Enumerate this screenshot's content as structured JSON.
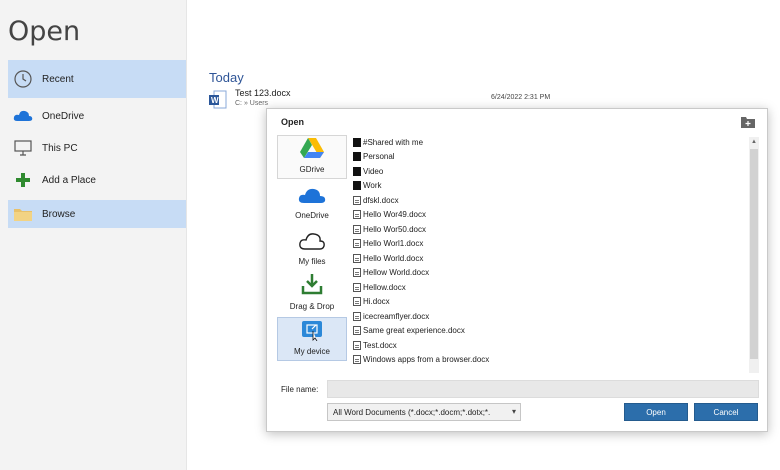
{
  "page": {
    "title": "Open"
  },
  "nav": {
    "recent": "Recent",
    "onedrive": "OneDrive",
    "thispc": "This PC",
    "addplace": "Add a Place",
    "browse": "Browse"
  },
  "recent_section": {
    "heading": "Today",
    "file": {
      "name": "Test 123.docx",
      "path": "C: » Users",
      "date": "6/24/2022 2:31 PM"
    }
  },
  "dialog": {
    "title": "Open",
    "sources": {
      "gdrive": "GDrive",
      "onedrive": "OneDrive",
      "myfiles": "My files",
      "dragdrop": "Drag & Drop",
      "mydevice": "My device"
    },
    "files": [
      {
        "name": "#Shared with me",
        "kind": "folder"
      },
      {
        "name": "Personal",
        "kind": "folder"
      },
      {
        "name": "Video",
        "kind": "folder"
      },
      {
        "name": "Work",
        "kind": "folder"
      },
      {
        "name": "dfskl.docx",
        "kind": "doc"
      },
      {
        "name": "Hello Wor49.docx",
        "kind": "doc"
      },
      {
        "name": "Hello Wor50.docx",
        "kind": "doc"
      },
      {
        "name": "Hello Worl1.docx",
        "kind": "doc"
      },
      {
        "name": "Hello World.docx",
        "kind": "doc"
      },
      {
        "name": "Hellow World.docx",
        "kind": "doc"
      },
      {
        "name": "Hellow.docx",
        "kind": "doc"
      },
      {
        "name": "Hi.docx",
        "kind": "doc"
      },
      {
        "name": "icecreamflyer.docx",
        "kind": "doc"
      },
      {
        "name": "Same great experience.docx",
        "kind": "doc"
      },
      {
        "name": "Test.docx",
        "kind": "doc"
      },
      {
        "name": "Windows apps from a browser.docx",
        "kind": "doc"
      }
    ],
    "filename_label": "File name:",
    "filename_value": "",
    "filter_selected": "All Word Documents (*.docx;*.docm;*.dotx;*.",
    "open_button": "Open",
    "cancel_button": "Cancel"
  },
  "colors": {
    "accent": "#2c6eab",
    "nav_selected": "#c7dcf5",
    "today_heading": "#2f5597"
  }
}
